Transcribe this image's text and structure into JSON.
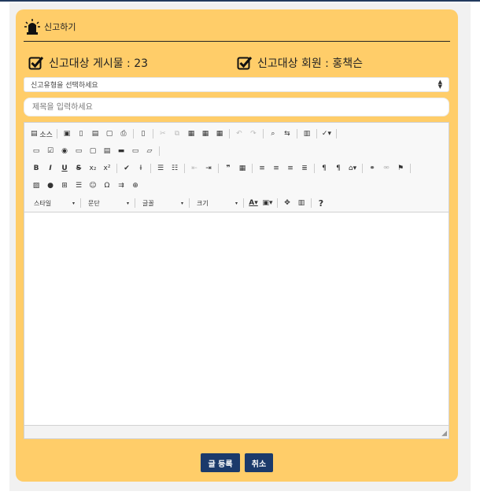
{
  "header": {
    "title": "신고하기",
    "icon": "siren-icon"
  },
  "targets": {
    "post_label": "신고대상 게시물 : 23",
    "member_label": "신고대상 회원 : 홍책슨"
  },
  "report_type": {
    "selected": "신고유형을 선택하세요"
  },
  "title_field": {
    "placeholder": "제목을 입력하세요",
    "value": ""
  },
  "toolbar": {
    "source_label": "소스",
    "styles_label": "스타일",
    "format_label": "문단",
    "font_label": "글꼴",
    "size_label": "크기",
    "help_label": "?",
    "italic_label": "I",
    "underline_label": "U",
    "strike_label": "S",
    "bold_label": "B"
  },
  "buttons": {
    "submit_label": "글 등록",
    "cancel_label": "취소"
  },
  "colors": {
    "card": "#ffcd69",
    "button": "#1b3a6b",
    "background": "#f1f1f1"
  }
}
